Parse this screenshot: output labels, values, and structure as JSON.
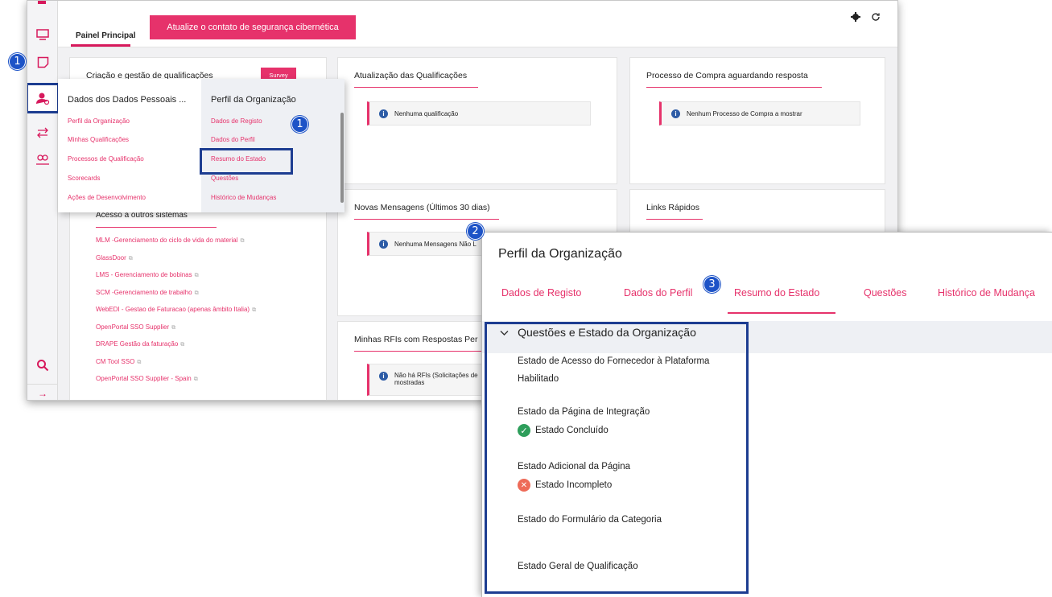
{
  "main_window": {
    "tab_label": "Painel Principal",
    "cyber_button": "Atualize o contato de segurança cibernética",
    "settings_icon": "gear-icon",
    "refresh_icon": "refresh-icon"
  },
  "sidebar": {
    "icons": [
      "desktop-icon",
      "note-icon",
      "user-profile-icon",
      "transfer-icon",
      "team-icon",
      "search-icon",
      "arrow-right-icon"
    ]
  },
  "cards": {
    "qualifications": {
      "title": "Criação e gestão de qualificações",
      "survey_button": "Survey"
    },
    "qual_updates": {
      "title": "Atualização das Qualificações",
      "message": "Nenhuma qualificação"
    },
    "purchase": {
      "title": "Processo de Compra aguardando resposta",
      "message": "Nenhum Processo de Compra a mostrar"
    },
    "messages": {
      "title": "Novas Mensagens (Últimos 30 dias)",
      "message": "Nenhuma Mensagens Não L"
    },
    "quick_links": {
      "title": "Links Rápidos"
    },
    "rfis": {
      "title": "Minhas RFIs com Respostas Per",
      "message_line1": "Não há RFIs (Solicitações de",
      "message_line2": "mostradas"
    }
  },
  "other_systems": {
    "title": "Acesso a outros sistemas",
    "links": [
      "MLM -Gerenciamento do ciclo de vida do material",
      "GlassDoor",
      "LMS - Gerenciamento de bobinas",
      "SCM -Gerenciamento de trabalho",
      "WebEDI - Gestao de Faturacao (apenas âmbito Italia)",
      "OpenPortal SSO Supplier",
      "DRAPE Gestão da faturação",
      "CM Tool SSO",
      "OpenPortal SSO Supplier - Spain"
    ]
  },
  "flyout": {
    "left_header": "Dados dos Dados Pessoais ...",
    "left_items": [
      "Perfil da Organização",
      "Minhas Qualificações",
      "Processos de Qualificação",
      "Scorecards",
      "Ações de Desenvolvimento"
    ],
    "right_header": "Perfil da Organização",
    "right_items": [
      "Dados de Registo",
      "Dados do Perfil",
      "Resumo do Estado",
      "Questões",
      "Histórico de Mudanças"
    ]
  },
  "badges": {
    "one": "1",
    "two": "2",
    "three": "3"
  },
  "detail": {
    "title": "Perfil da Organização",
    "tabs": [
      "Dados de Registo",
      "Dados do Perfil",
      "Resumo do Estado",
      "Questões",
      "Histórico de Mudança"
    ],
    "active_tab": "Resumo do Estado",
    "section_title": "Questões e Estado da Organização",
    "items": [
      {
        "label": "Estado de Acesso do Fornecedor à Plataforma",
        "value": "Habilitado"
      },
      {
        "label": "Estado da Página de Integração",
        "value": "Estado Concluído"
      },
      {
        "label": "Estado Adicional da Página",
        "value": "Estado Incompleto"
      },
      {
        "label": "Estado do Formulário da Categoria"
      },
      {
        "label": "Estado Geral de Qualificação"
      }
    ],
    "colors": {
      "accent": "#e6326b",
      "highlight": "#1d3d91",
      "ok": "#2e9e5b",
      "bad": "#ee6b58"
    }
  }
}
